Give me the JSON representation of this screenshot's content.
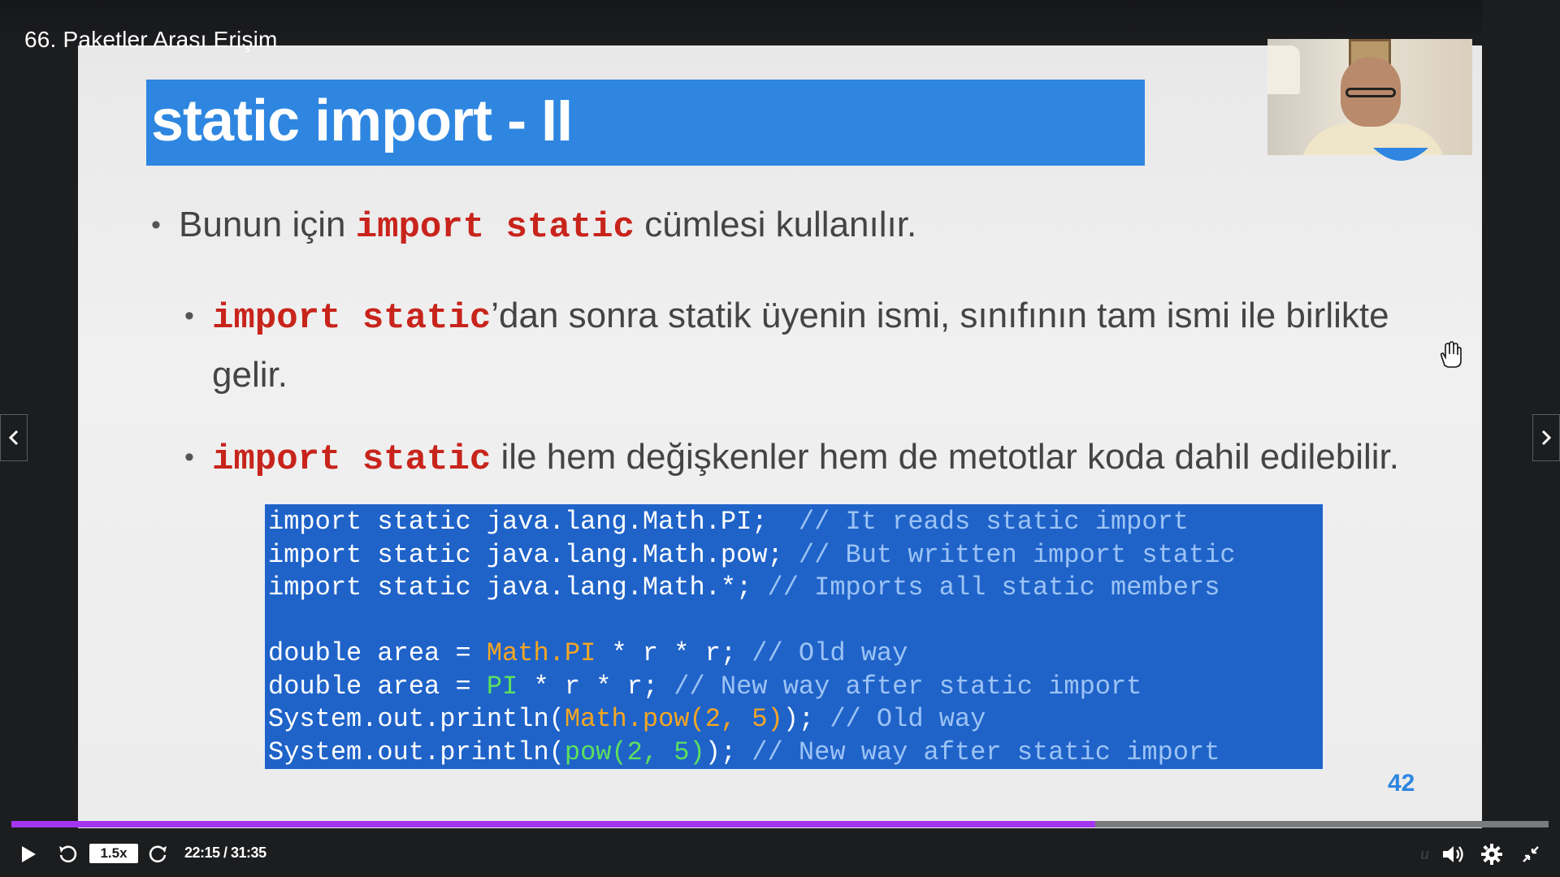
{
  "lecture": {
    "title": "66. Paketler Arası Erişim"
  },
  "slide": {
    "title": "static import - II",
    "bullets": [
      {
        "keyword": "",
        "pre": "Bunun için ",
        "kw": "import static",
        "post": " cümlesi kullanılır."
      },
      {
        "kw": "import static",
        "post": "’dan sonra statik üyenin ismi, sınıfının tam ismi ile birlikte",
        "post2": "gelir."
      },
      {
        "kw": "import static",
        "post": " ile hem değişkenler hem de metotlar koda dahil edilebilir."
      }
    ],
    "code": {
      "l1_code": "import static java.lang.Math.PI;  ",
      "l1_comment": "// It reads static import",
      "l2_code": "import static java.lang.Math.pow; ",
      "l2_comment": "// But written import static",
      "l3_code": "import static java.lang.Math.*; ",
      "l3_comment": "// Imports all static members",
      "l5_a": "double area = ",
      "l5_b": "Math.PI",
      "l5_c": " * r * r; ",
      "l5_comment": "// Old way",
      "l6_a": "double area = ",
      "l6_b": "PI",
      "l6_c": " * r * r; ",
      "l6_comment": "// New way after static import",
      "l7_a": "System.out.println(",
      "l7_b": "Math.pow(2, 5)",
      "l7_c": "); ",
      "l7_comment": "// Old way",
      "l8_a": "System.out.println(",
      "l8_b": "pow(2, 5)",
      "l8_c": "); ",
      "l8_comment": "// New way after static import"
    },
    "page_number": "42"
  },
  "player": {
    "speed": "1.5x",
    "time": "22:15 / 31:35",
    "progress": 0.705,
    "watermark": "u",
    "colors": {
      "progress": "#a435f0",
      "slide_accent": "#2e86e0",
      "code_bg": "#1f63c9",
      "keyword": "#c8241c"
    }
  }
}
